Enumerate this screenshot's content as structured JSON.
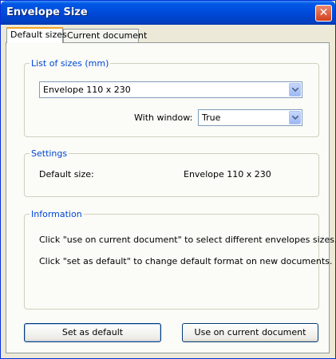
{
  "window": {
    "title": "Envelope Size",
    "close_icon": "close-icon"
  },
  "tabs": [
    {
      "label": "Default sizes",
      "active": true
    },
    {
      "label": "Current document",
      "active": false
    }
  ],
  "list_of_sizes": {
    "legend": "List of sizes (mm)",
    "size_select": {
      "value": "Envelope 110 x 230"
    },
    "with_window_label": "With window:",
    "with_window_select": {
      "value": "True"
    }
  },
  "settings": {
    "legend": "Settings",
    "default_size_label": "Default size:",
    "default_size_value": "Envelope 110 x 230"
  },
  "information": {
    "legend": "Information",
    "line1": "Click \"use on current document\" to select different envelopes sizes.",
    "line2": "Click \"set as default\" to change default format on new documents."
  },
  "buttons": {
    "set_default": "Set as default",
    "use_current": "Use on current document"
  },
  "colors": {
    "titlebar": "#0046d5",
    "accent_tab": "#f4a326",
    "group_title": "#0046d5",
    "dialog_bg": "#ece9d8"
  }
}
